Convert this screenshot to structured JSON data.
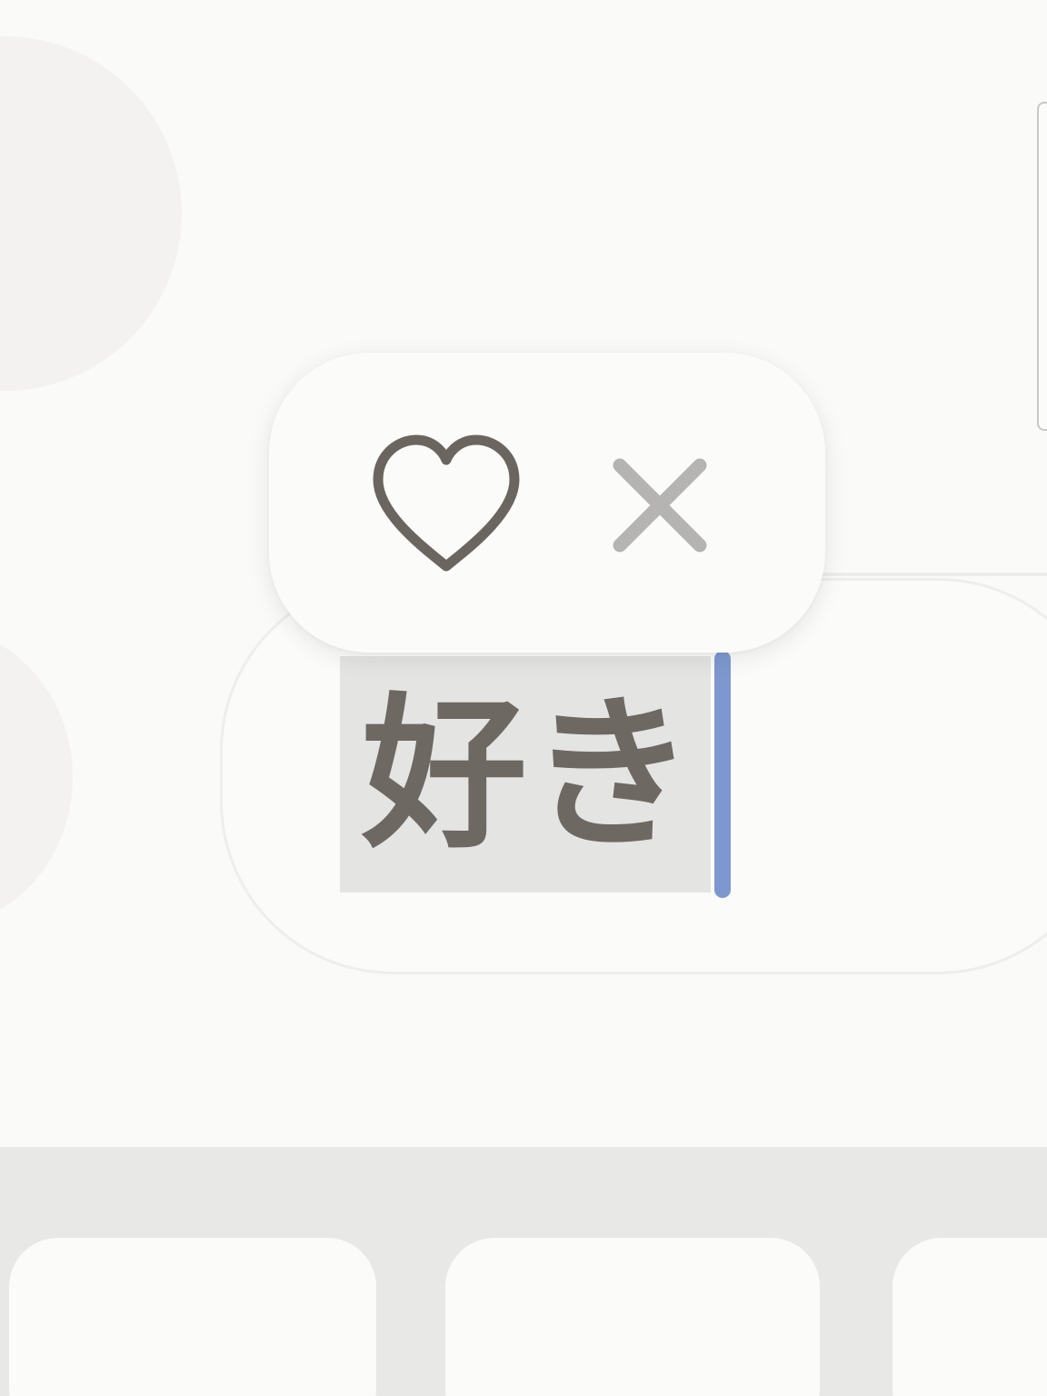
{
  "input": {
    "composed_text": "好き"
  },
  "reactions": {
    "like_icon": "heart-outline-icon",
    "dismiss_icon": "close-icon"
  },
  "colors": {
    "caret": "#7e98cf",
    "selection": "#e4e4e3",
    "text": "#6e6863",
    "heart_stroke": "#6b6560",
    "close_stroke": "#b5b4b2"
  }
}
